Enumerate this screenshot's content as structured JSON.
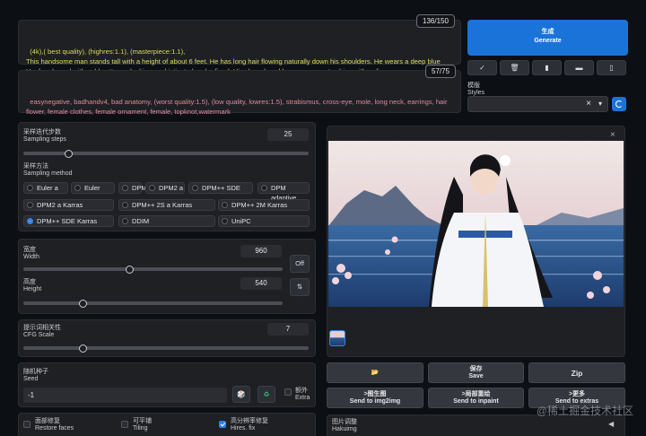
{
  "prompt": {
    "positive_text": "(4k),( best quality), (highres:1.1), (masterpiece:1.1),\nThis handsome man stands tall with a height of about 6 feet. He has long hair flowing naturally down his shoulders. He wears a deep blue Hanfu adorned with gold patterns, looking sophisticated and refined. His clear deep blue eyes seem to shine with radiance.",
    "positive_counter": "136/150",
    "negative_text": "easynegative, badhandv4, bad anatomy, (worst quality:1.5), (low quality, lowres:1.5), strabismus, cross-eye, mole, long neck, earrings, hair flower, female clothes, female ornament, female, topknot,watermark",
    "negative_counter": "57/75"
  },
  "generate": {
    "label_cn": "生成",
    "label_en": "Generate"
  },
  "tools": [
    "✓",
    "🗑",
    "▮",
    "▬",
    "▯"
  ],
  "styles": {
    "label_cn": "模版",
    "label_en": "Styles",
    "clear": "×",
    "arrow": "▾"
  },
  "sampling_steps": {
    "label_cn": "采样迭代步数",
    "label_en": "Sampling steps",
    "value": "25",
    "fraction": 0.16
  },
  "sampling_method": {
    "label_cn": "采样方法",
    "label_en": "Sampling method",
    "options": [
      "Euler a",
      "Euler",
      "DPM2",
      "DPM2 a",
      "DPM++ SDE",
      "DPM adaptive",
      "DPM2 a Karras",
      "DPM++ 2S a Karras",
      "DPM++ 2M Karras",
      "DPM++ SDE Karras",
      "DDIM",
      "UniPC"
    ],
    "selected": "DPM++ SDE Karras"
  },
  "width": {
    "label_cn": "宽度",
    "label_en": "Width",
    "value": "960",
    "fraction": 0.41
  },
  "height": {
    "label_cn": "高度",
    "label_en": "Height",
    "value": "540",
    "fraction": 0.23
  },
  "off_label": "Off",
  "swap_label": "⇅",
  "cfg": {
    "label_cn": "提示词相关性",
    "label_en": "CFG Scale",
    "value": "7",
    "fraction": 0.21
  },
  "seed": {
    "label_cn": "随机种子",
    "label_en": "Seed",
    "value": "-1",
    "extra_cn": "额外",
    "extra_en": "Extra",
    "dice": "🎲",
    "recycle": "♻"
  },
  "bottom_options": [
    {
      "cn": "面部修复",
      "en": "Restore faces",
      "checked": false
    },
    {
      "cn": "可平铺",
      "en": "Tiling",
      "checked": false
    },
    {
      "cn": "高分辨率修复",
      "en": "Hires. fix",
      "checked": true
    }
  ],
  "image_panel": {
    "close": "×"
  },
  "actions": [
    {
      "cn": "",
      "en": "",
      "icon": "📂"
    },
    {
      "cn": "保存",
      "en": "Save"
    },
    {
      "cn": "",
      "en": "Zip"
    },
    {
      "cn": ">图生图",
      "en": "Send to img2img"
    },
    {
      "cn": ">局部重绘",
      "en": "Send to inpaint"
    },
    {
      "cn": ">更多",
      "en": "Send to extras"
    }
  ],
  "hakuimg": {
    "cn": "图片调整",
    "en": "Hakuimg",
    "arrow": "◀"
  },
  "watermark": "@稀土掘金技术社区",
  "colors": {
    "accent": "#1a73d9",
    "positive": "#d8dc5a",
    "negative": "#e08a98"
  }
}
